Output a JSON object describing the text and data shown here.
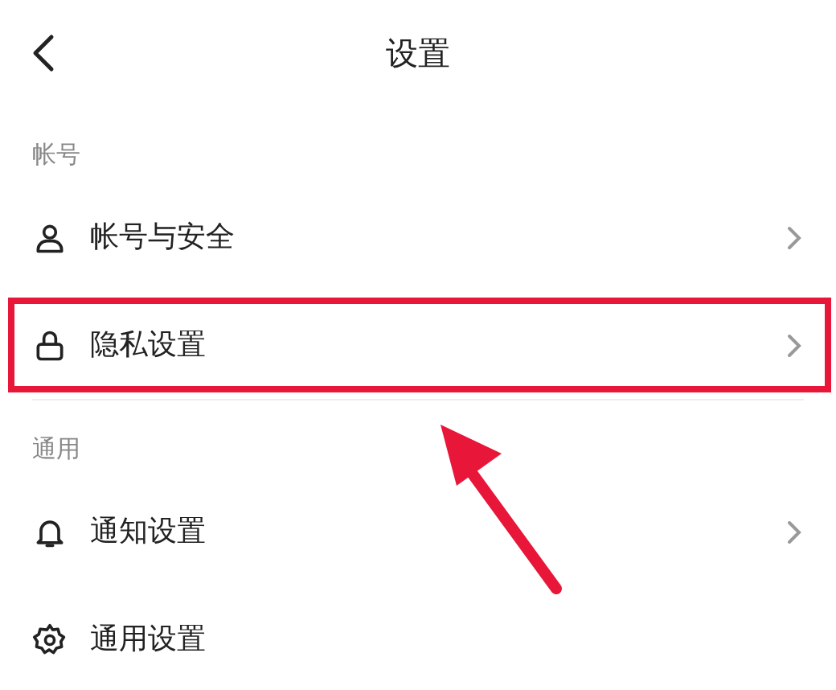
{
  "header": {
    "title": "设置"
  },
  "sections": [
    {
      "label": "帐号",
      "items": [
        {
          "label": "帐号与安全",
          "highlighted": false,
          "chevron": true
        },
        {
          "label": "隐私设置",
          "highlighted": true,
          "chevron": true
        }
      ]
    },
    {
      "label": "通用",
      "items": [
        {
          "label": "通知设置",
          "highlighted": false,
          "chevron": true
        },
        {
          "label": "通用设置",
          "highlighted": false,
          "chevron": false
        }
      ]
    }
  ]
}
